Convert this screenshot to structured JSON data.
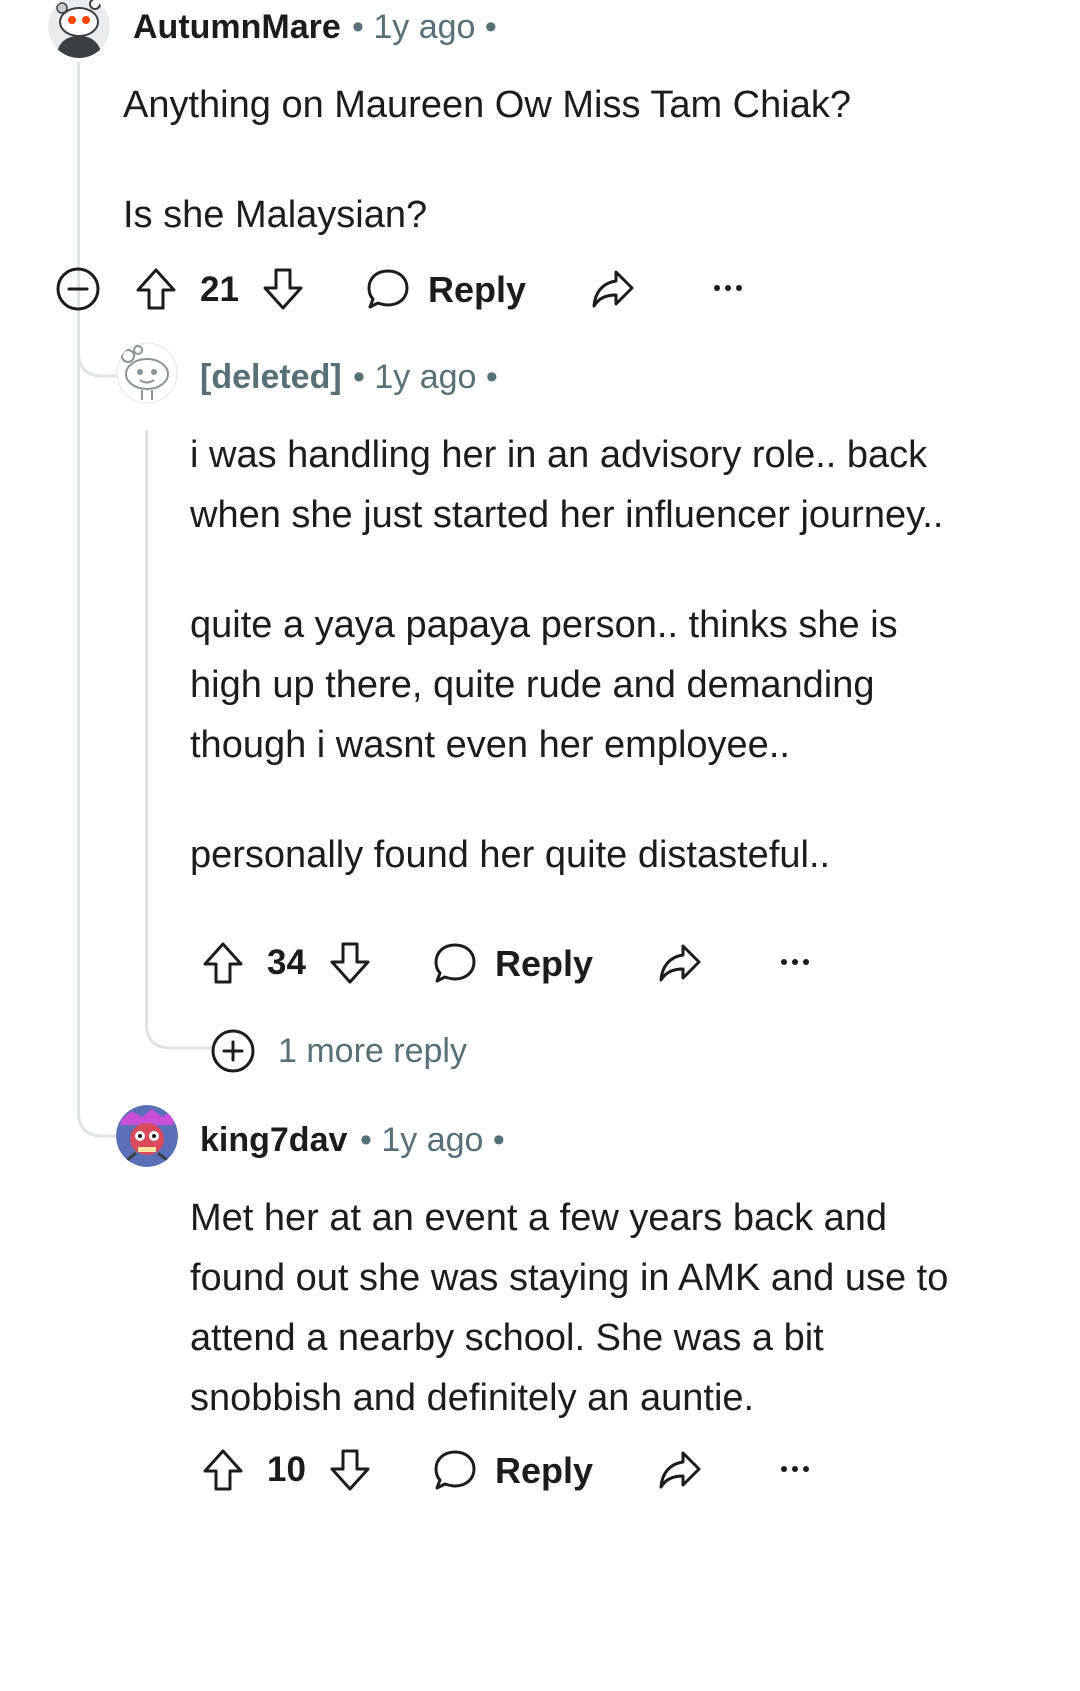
{
  "comments": [
    {
      "username": "AutumnMare",
      "meta": "• 1y ago •",
      "paragraphs": [
        "Anything on Maureen Ow Miss Tam Chiak?",
        "Is she Malaysian?"
      ],
      "vote_count": "21",
      "reply_label": "Reply"
    },
    {
      "username": "[deleted]",
      "meta": "• 1y ago •",
      "paragraphs": [
        "i was handling her in an advisory role.. back when she just started her influencer journey..",
        "quite a yaya papaya person.. thinks she is high up there, quite rude and demanding though i wasnt even her employee..",
        "personally found her quite distasteful.."
      ],
      "vote_count": "34",
      "reply_label": "Reply",
      "more_replies": "1 more reply"
    },
    {
      "username": "king7dav",
      "meta": "• 1y ago •",
      "paragraphs": [
        "Met her at an event a few years back and found out she was staying in AMK and use to attend a nearby school. She was a bit snobbish and definitely an auntie."
      ],
      "vote_count": "10",
      "reply_label": "Reply"
    }
  ],
  "icons": {
    "collapse": "minus-circle-icon",
    "upvote": "arrow-up-icon",
    "downvote": "arrow-down-icon",
    "reply": "speech-bubble-icon",
    "share": "share-arrow-icon",
    "more": "ellipsis-icon",
    "expand": "plus-circle-icon"
  },
  "colors": {
    "text": "#1c1c1c",
    "meta": "#576f76",
    "thread_line": "#dfe3e6"
  }
}
